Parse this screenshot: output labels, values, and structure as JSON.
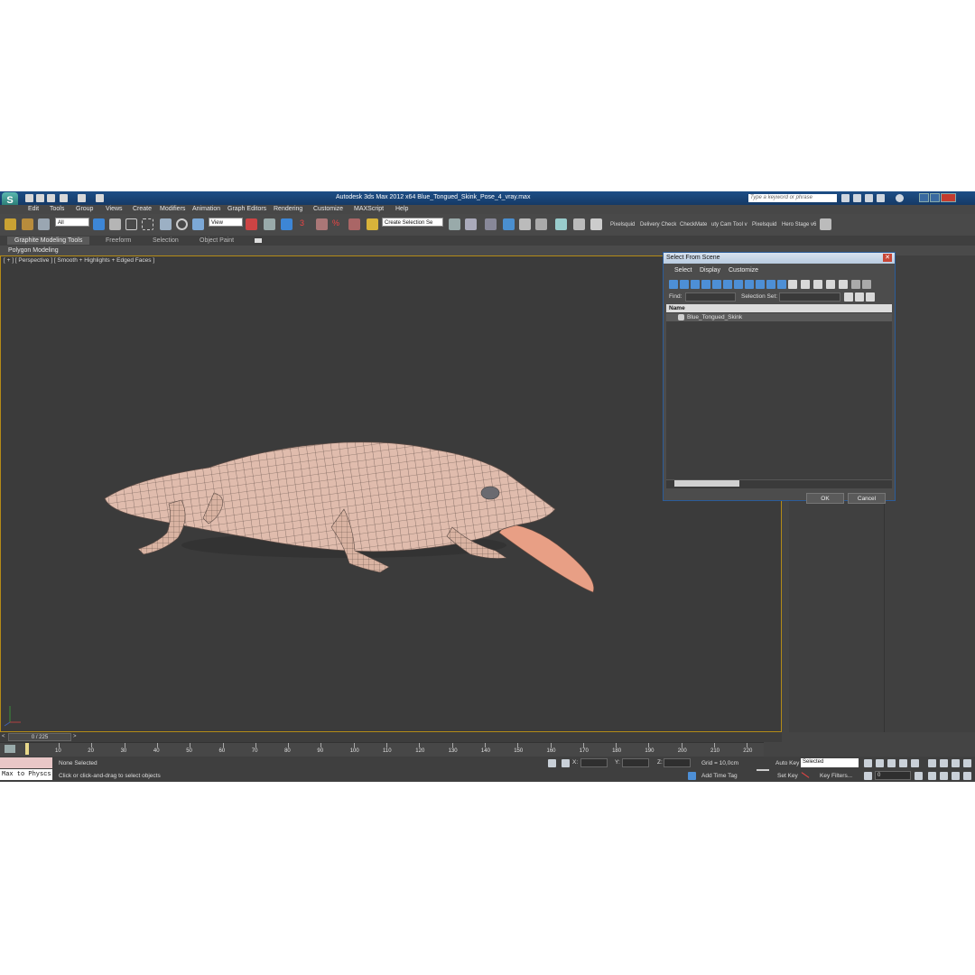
{
  "window": {
    "title": "Autodesk 3ds Max  2012 x64     Blue_Tongued_Skink_Pose_4_vray.max",
    "search_placeholder": "Type a keyword or phrase"
  },
  "menu": [
    "Edit",
    "Tools",
    "Group",
    "Views",
    "Create",
    "Modifiers",
    "Animation",
    "Graph Editors",
    "Rendering",
    "Customize",
    "MAXScript",
    "Help"
  ],
  "toolbar": {
    "selection_filter": "All",
    "reference_coord": "View",
    "named_selection": "Create Selection Se",
    "plugins": [
      "Pixelsquid",
      "Delivery Check",
      "CheckMate",
      "uty Cam Tool v",
      "Pixelsquid",
      "Hero Stage v6"
    ]
  },
  "ribbon": {
    "tabs": [
      "Graphite Modeling Tools",
      "Freeform",
      "Selection",
      "Object Paint"
    ],
    "panel": "Polygon Modeling"
  },
  "viewport": {
    "label": "[ + ] [ Perspective ] [ Smooth + Highlights + Edged Faces ]"
  },
  "dialog": {
    "title": "Select From Scene",
    "menu": [
      "Select",
      "Display",
      "Customize"
    ],
    "find_label": "Find:",
    "selection_set_label": "Selection Set:",
    "column_name": "Name",
    "items": [
      "Blue_Tongued_Skink"
    ],
    "ok": "OK",
    "cancel": "Cancel"
  },
  "timeline": {
    "slider": "0 / 225",
    "ticks": [
      "10",
      "20",
      "30",
      "40",
      "50",
      "60",
      "70",
      "80",
      "90",
      "100",
      "110",
      "120",
      "130",
      "140",
      "150",
      "160",
      "170",
      "180",
      "190",
      "200",
      "210",
      "220"
    ]
  },
  "status": {
    "listener": "Max to Physcs",
    "selection": "None Selected",
    "prompt": "Click or click-and-drag to select objects",
    "x_label": "X:",
    "y_label": "Y:",
    "z_label": "Z:",
    "grid": "Grid = 10,0cm",
    "add_time_tag": "Add Time Tag",
    "auto_key": "Auto Key",
    "auto_key_mode": "Selected",
    "set_key": "Set Key",
    "key_filters": "Key Filters...",
    "frame": "0"
  },
  "colors": {
    "viewport_bg": "#3b3b3b",
    "active_border": "#b48b17",
    "titlebar": "#1d4e86",
    "mesh": "#e0b9a8"
  }
}
